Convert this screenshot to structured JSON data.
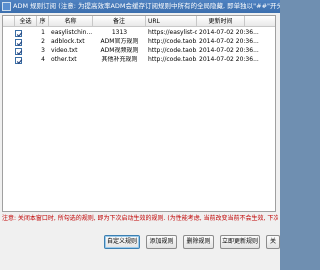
{
  "window": {
    "title": "ADM 规则订阅 (注意: 为提高效率ADM会缓存订阅规则中所有的全局隐藏, 即单独以\"##\"开头的规则)"
  },
  "table": {
    "headers": {
      "select_all": "全选",
      "index": "序",
      "name": "名称",
      "remark": "备注",
      "url": "URL",
      "updated": "更新时间"
    },
    "rows": [
      {
        "checked": true,
        "index": "1",
        "name": "easylistchin...",
        "remark": "1313",
        "url": "https://easylist-d...",
        "updated": "2014-07-02 20:36..."
      },
      {
        "checked": true,
        "index": "2",
        "name": "adblock.txt",
        "remark": "ADM官方规则",
        "url": "http://code.taob...",
        "updated": "2014-07-02 20:36..."
      },
      {
        "checked": true,
        "index": "3",
        "name": "video.txt",
        "remark": "ADM视频规则",
        "url": "http://code.taob...",
        "updated": "2014-07-02 20:36..."
      },
      {
        "checked": true,
        "index": "4",
        "name": "other.txt",
        "remark": "其他补充规则",
        "url": "http://code.taob...",
        "updated": "2014-07-02 20:36..."
      }
    ]
  },
  "status_note": "注意: 关闭本窗口时, 所勾选的规则, 即为下次启动生效的规则. (为性能考虑, 当前改变当前不会生效, 下次主程序启动生效)",
  "buttons": {
    "custom_rules": "自定义规则",
    "add_rule": "添加规则",
    "delete_rule": "删除规则",
    "update_now": "立即更新规则",
    "close": "关"
  }
}
